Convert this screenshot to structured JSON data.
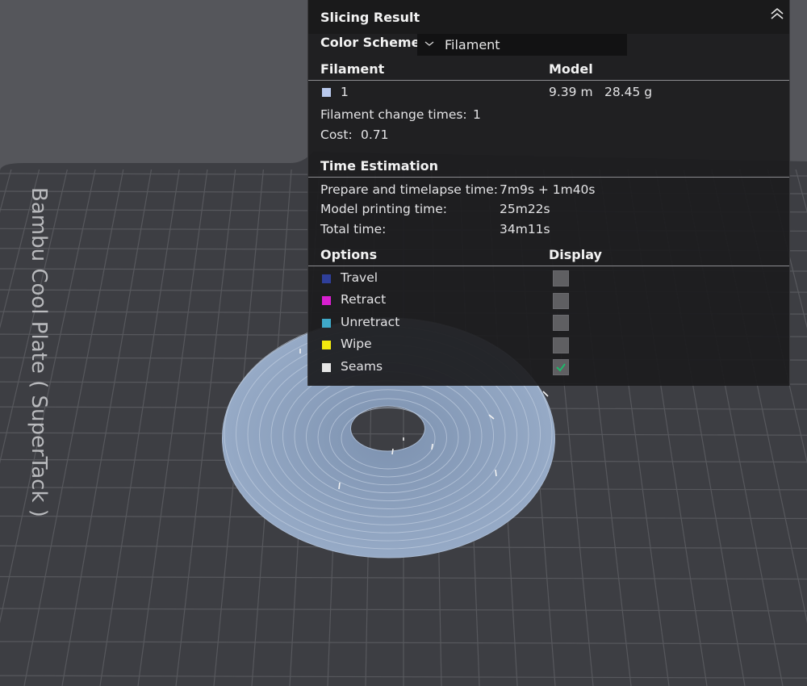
{
  "panel": {
    "title": "Slicing Result",
    "color_scheme_label": "Color Scheme",
    "color_scheme_value": "Filament",
    "filament_header": "Filament",
    "model_header": "Model",
    "filament_index": "1",
    "filament_color": "#b8c8ec",
    "filament_length": "9.39 m",
    "filament_weight": "28.45 g",
    "change_times_label": "Filament change times:",
    "change_times_value": "1",
    "cost_label": "Cost:",
    "cost_value": "0.71",
    "time_header": "Time Estimation",
    "prepare_label": "Prepare and timelapse time:",
    "prepare_value": "7m9s + 1m40s",
    "model_print_label": "Model printing time:",
    "model_print_value": "25m22s",
    "total_label": "Total time:",
    "total_value": "34m11s",
    "options_header": "Options",
    "display_header": "Display",
    "options": [
      {
        "label": "Travel",
        "color": "#2f3f9a",
        "checked": false
      },
      {
        "label": "Retract",
        "color": "#d81fd0",
        "checked": false
      },
      {
        "label": "Unretract",
        "color": "#3fa9c9",
        "checked": false
      },
      {
        "label": "Wipe",
        "color": "#f2ea0e",
        "checked": false
      },
      {
        "label": "Seams",
        "color": "#e6e6e6",
        "checked": true
      }
    ]
  },
  "plate": {
    "label": "Bambu Cool Plate ( SuperTack )",
    "plate_color": "#3c3d42",
    "grid_color": "#56575c",
    "model_color": "#8ea4c2"
  }
}
